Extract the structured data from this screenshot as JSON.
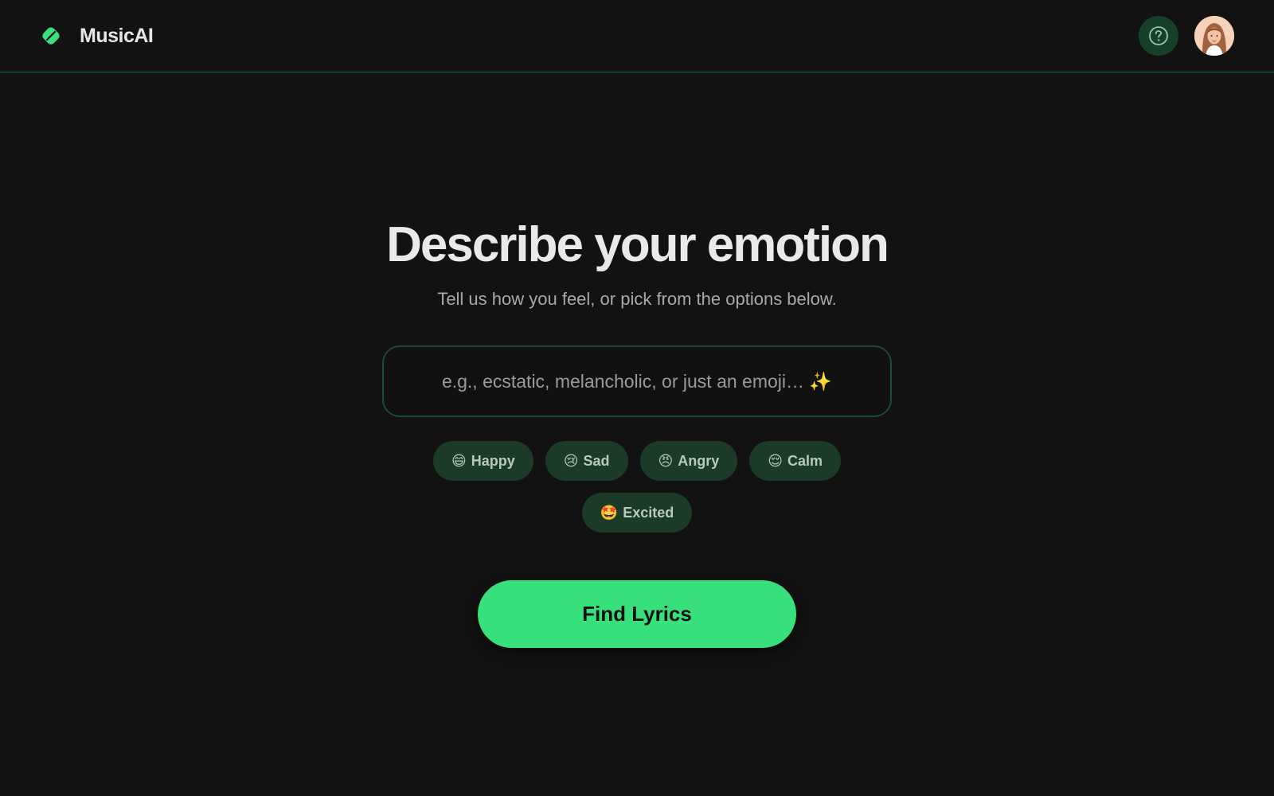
{
  "app": {
    "name": "MusicAI",
    "accent_color": "#38e07b",
    "background_color": "#121212"
  },
  "header": {
    "logo_icon": "guitar-pick-icon",
    "help_icon": "question-circle-icon",
    "avatar_icon": "user-avatar"
  },
  "main": {
    "title": "Describe your emotion",
    "subtitle": "Tell us how you feel, or pick from the options below.",
    "input": {
      "value": "",
      "placeholder": "e.g., ecstatic, melancholic, or just an emoji… ✨"
    },
    "chips": [
      {
        "emoji": "😄",
        "label": "Happy"
      },
      {
        "emoji": "😢",
        "label": "Sad"
      },
      {
        "emoji": "😠",
        "label": "Angry"
      },
      {
        "emoji": "😌",
        "label": "Calm"
      },
      {
        "emoji": "🤩",
        "label": "Excited"
      }
    ],
    "cta_label": "Find Lyrics"
  }
}
